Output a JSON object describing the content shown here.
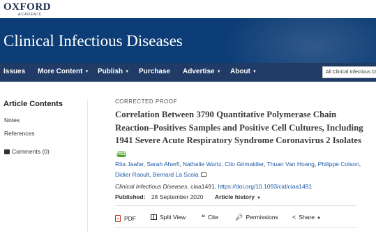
{
  "logo": {
    "name": "OXFORD",
    "sub": "ACADEMIC"
  },
  "journal": {
    "title": "Clinical Infectious Diseases"
  },
  "nav": {
    "items": [
      "Issues",
      "More Content",
      "Publish",
      "Purchase",
      "Advertise",
      "About"
    ],
    "search_scope": "All Clinical Infectious Dis"
  },
  "sidebar": {
    "heading": "Article Contents",
    "links": [
      "Notes",
      "References"
    ],
    "comments": "Comments (0)"
  },
  "article": {
    "kicker": "CORRECTED PROOF",
    "title": "Correlation Between 3790 Quantitative Polymerase Chain Reaction–Positives Samples and Positive Cell Cultures, Including 1941 Severe Acute Respiratory Syndrome Coronavirus 2 Isolates",
    "free_badge": "FREE",
    "authors": [
      "Rita Jaafar",
      "Sarah Aherfi",
      "Nathalie Wurtz",
      "Clio Grimaldier",
      "Thuan Van Hoang",
      "Philippe Colson",
      "Didier Raoult",
      "Bernard La Scola"
    ],
    "journal_italic": "Clinical Infectious Diseases",
    "article_id": "ciaa1491",
    "doi": "https://doi.org/10.1093/cid/ciaa1491",
    "published_label": "Published:",
    "published_date": "28 September 2020",
    "history_label": "Article history"
  },
  "toolbar": {
    "pdf": "PDF",
    "split_view": "Split View",
    "cite": "Cite",
    "permissions": "Permissions",
    "share": "Share"
  },
  "colors": {
    "banner": "#0d3d76",
    "nav": "#1f3b66",
    "link": "#1a5aa8",
    "free": "#4a9f2e"
  }
}
